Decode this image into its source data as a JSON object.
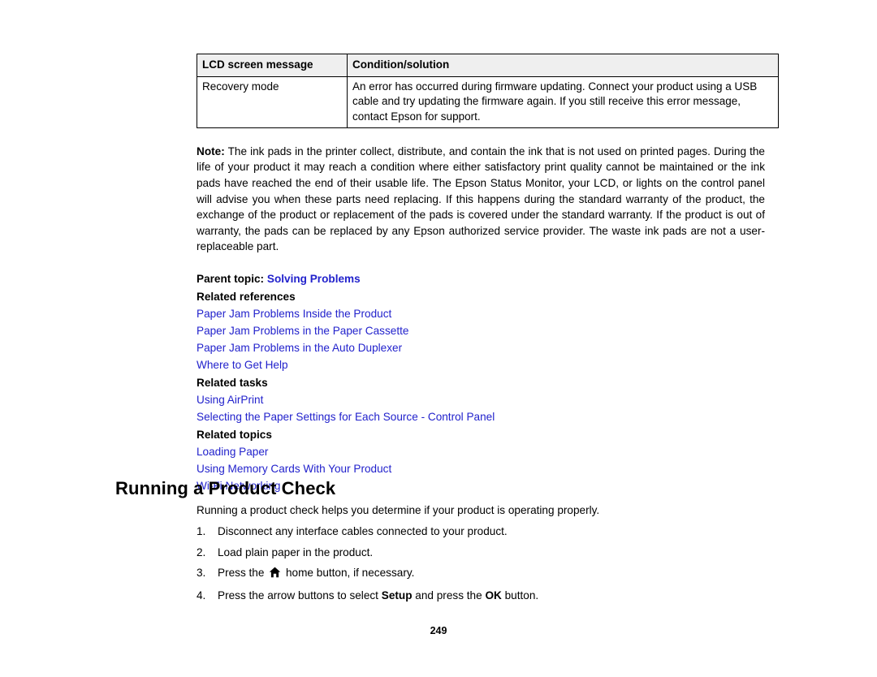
{
  "table": {
    "headers": [
      "LCD screen message",
      "Condition/solution"
    ],
    "rows": [
      {
        "message": "Recovery mode",
        "solution": "An error has occurred during firmware updating. Connect your product using a USB cable and try updating the firmware again. If you still receive this error message, contact Epson for support."
      }
    ]
  },
  "note": {
    "label": "Note:",
    "text": " The ink pads in the printer collect, distribute, and contain the ink that is not used on printed pages. During the life of your product it may reach a condition where either satisfactory print quality cannot be maintained or the ink pads have reached the end of their usable life. The Epson Status Monitor, your LCD, or lights on the control panel will advise you when these parts need replacing. If this happens during the standard warranty of the product, the exchange of the product or replacement of the pads is covered under the standard warranty. If the product is out of warranty, the pads can be replaced by any Epson authorized service provider. The waste ink pads are not a user-replaceable part."
  },
  "parent_topic": {
    "label": "Parent topic:",
    "link": "Solving Problems"
  },
  "related_references": {
    "heading": "Related references",
    "links": [
      "Paper Jam Problems Inside the Product",
      "Paper Jam Problems in the Paper Cassette",
      "Paper Jam Problems in the Auto Duplexer",
      "Where to Get Help"
    ]
  },
  "related_tasks": {
    "heading": "Related tasks",
    "links": [
      "Using AirPrint",
      "Selecting the Paper Settings for Each Source - Control Panel"
    ]
  },
  "related_topics": {
    "heading": "Related topics",
    "links": [
      "Loading Paper",
      "Using Memory Cards With Your Product",
      "Wi-Fi Networking"
    ]
  },
  "section": {
    "title": "Running a Product Check",
    "intro": "Running a product check helps you determine if your product is operating properly.",
    "steps": [
      {
        "num": "1.",
        "pre": "Disconnect any interface cables connected to your product.",
        "icon": false
      },
      {
        "num": "2.",
        "pre": "Load plain paper in the product.",
        "icon": false
      },
      {
        "num": "3.",
        "pre": "Press the ",
        "icon": true,
        "icon_name": "home-icon",
        "post": " home button, if necessary."
      },
      {
        "num": "4.",
        "pre": "Press the arrow buttons to select ",
        "bold1": "Setup",
        "mid": " and press the ",
        "bold2": "OK",
        "post": " button.",
        "icon": false
      }
    ]
  },
  "footer": {
    "page_number": "249"
  },
  "colors": {
    "link": "#2222cc",
    "table_header_bg": "#efefef",
    "text": "#000000"
  }
}
